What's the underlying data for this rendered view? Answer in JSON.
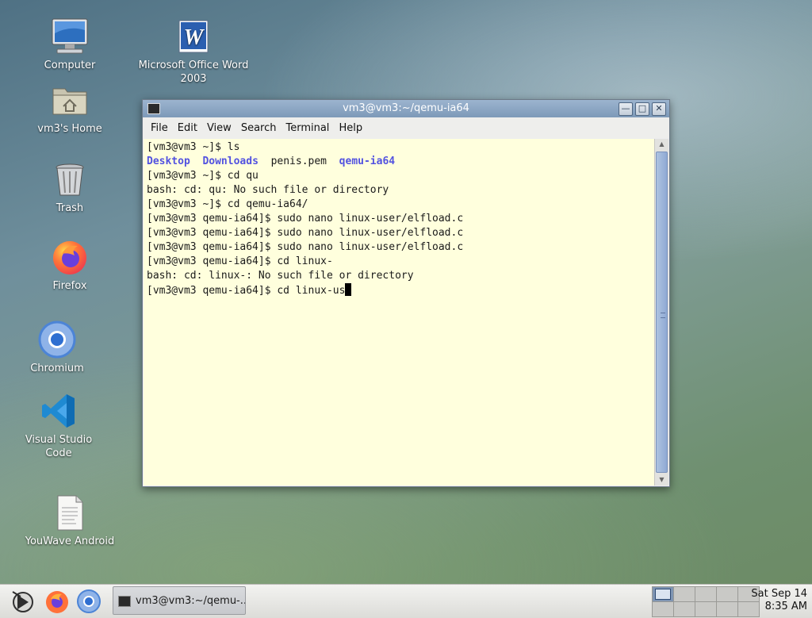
{
  "desktop": {
    "icons": [
      {
        "label": "Computer"
      },
      {
        "label": "Microsoft Office Word 2003"
      },
      {
        "label": "vm3's Home"
      },
      {
        "label": "Trash"
      },
      {
        "label": "Firefox"
      },
      {
        "label": "Chromium"
      },
      {
        "label": "Visual Studio Code"
      },
      {
        "label": "YouWave Android"
      }
    ]
  },
  "terminal": {
    "title": "vm3@vm3:~/qemu-ia64",
    "menu": [
      "File",
      "Edit",
      "View",
      "Search",
      "Terminal",
      "Help"
    ],
    "lines": {
      "l1": "[vm3@vm3 ~]$ ls",
      "ls_desktop": "Desktop",
      "ls_downloads": "Downloads",
      "ls_penis": "penis.pem",
      "ls_qemu": "qemu-ia64",
      "l3": "[vm3@vm3 ~]$ cd qu",
      "l4": "bash: cd: qu: No such file or directory",
      "l5": "[vm3@vm3 ~]$ cd qemu-ia64/",
      "l6": "[vm3@vm3 qemu-ia64]$ sudo nano linux-user/elfload.c",
      "l7": "[vm3@vm3 qemu-ia64]$ sudo nano linux-user/elfload.c",
      "l8": "[vm3@vm3 qemu-ia64]$ sudo nano linux-user/elfload.c",
      "l9": "[vm3@vm3 qemu-ia64]$ cd linux-",
      "l10": "bash: cd: linux-: No such file or directory",
      "l11": "[vm3@vm3 qemu-ia64]$ cd linux-us"
    },
    "colors": {
      "background": "#ffffdd",
      "directory": "#5252e0"
    }
  },
  "taskbar": {
    "task_label": "vm3@vm3:~/qemu-...",
    "clock": {
      "date": "Sat Sep 14",
      "time": "8:35 AM"
    },
    "workspaces": 10,
    "active_workspace": 1
  }
}
